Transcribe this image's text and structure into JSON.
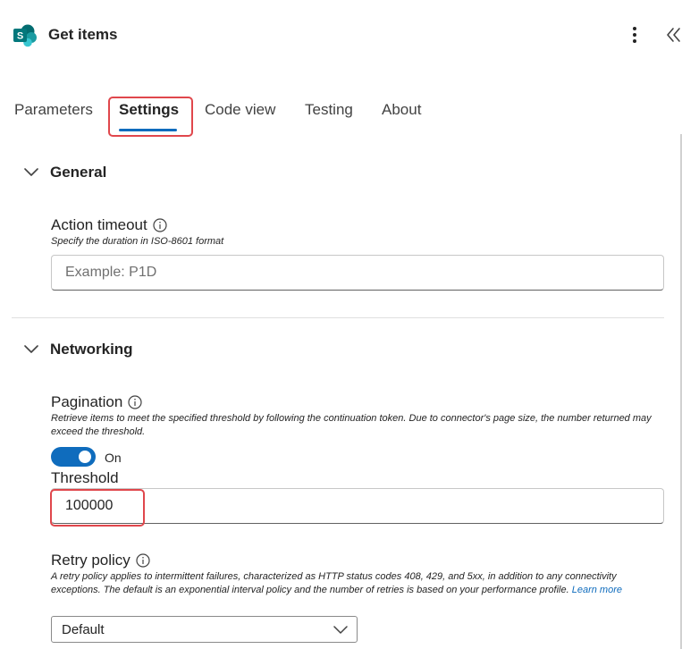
{
  "header": {
    "title": "Get items",
    "logo_letter": "S"
  },
  "tabs": [
    {
      "label": "Parameters",
      "active": false
    },
    {
      "label": "Settings",
      "active": true
    },
    {
      "label": "Code view",
      "active": false
    },
    {
      "label": "Testing",
      "active": false
    },
    {
      "label": "About",
      "active": false
    }
  ],
  "sections": {
    "general": {
      "title": "General",
      "action_timeout": {
        "label": "Action timeout",
        "description": "Specify the duration in ISO-8601 format",
        "value": "",
        "placeholder": "Example: P1D"
      }
    },
    "networking": {
      "title": "Networking",
      "pagination": {
        "label": "Pagination",
        "description": "Retrieve items to meet the specified threshold by following the continuation token. Due to connector's page size, the number returned may exceed the threshold.",
        "toggle_state": "On",
        "enabled": true
      },
      "threshold": {
        "label": "Threshold",
        "value": "100000"
      },
      "retry_policy": {
        "label": "Retry policy",
        "description": "A retry policy applies to intermittent failures, characterized as HTTP status codes 408, 429, and 5xx, in addition to any connectivity exceptions. The default is an exponential interval policy and the number of retries is based on your performance profile.",
        "learn_more": "Learn more",
        "selected": "Default"
      }
    }
  },
  "colors": {
    "accent": "#0f6cbd",
    "highlight": "#e0474c",
    "logo_dark": "#036c70",
    "logo_teal": "#1a9ba1",
    "logo_light": "#37c6d0"
  }
}
